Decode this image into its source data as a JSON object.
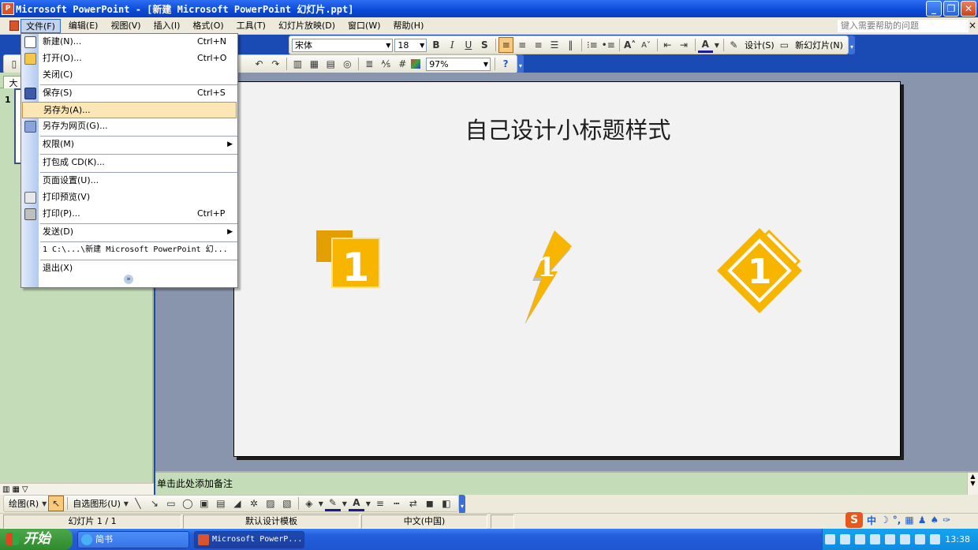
{
  "window": {
    "title": "Microsoft PowerPoint - [新建 Microsoft PowerPoint 幻灯片.ppt]",
    "app_icon": "powerpoint-icon",
    "controls": [
      "minimize",
      "restore",
      "close"
    ]
  },
  "menubar": {
    "items": [
      "文件(F)",
      "编辑(E)",
      "视图(V)",
      "插入(I)",
      "格式(O)",
      "工具(T)",
      "幻灯片放映(D)",
      "窗口(W)",
      "帮助(H)"
    ],
    "active_index": 0,
    "help_placeholder": "键入需要帮助的问题",
    "close_glyph": "×"
  },
  "formatting_toolbar": {
    "font": "宋体",
    "size": "18",
    "design_label": "设计(S)",
    "new_slide_label": "新幻灯片(N)"
  },
  "standard_toolbar": {
    "zoom": "97%"
  },
  "outline_pane": {
    "tab_label": "大",
    "slide_number": "1"
  },
  "slide": {
    "title": "自己设计小标题样式",
    "icon_labels": [
      "1",
      "1",
      "1"
    ],
    "accent_color": "#f7b500",
    "dark_color": "#e39f00"
  },
  "notes": {
    "placeholder": "单击此处添加备注"
  },
  "view_buttons": [
    "normal-view",
    "slide-sorter-view",
    "slide-show-view"
  ],
  "draw_toolbar": {
    "draw_label": "绘图(R)",
    "autoshapes_label": "自选图形(U)"
  },
  "statusbar": {
    "slide_info": "幻灯片 1 / 1",
    "template": "默认设计模板",
    "language": "中文(中国)"
  },
  "ime": {
    "mode": "中"
  },
  "taskbar": {
    "start_label": "开始",
    "tasks": [
      "简书",
      "Microsoft PowerP..."
    ],
    "clock": "13:38"
  },
  "file_menu": {
    "items": [
      {
        "label": "新建(N)...",
        "shortcut": "Ctrl+N",
        "icon": "new-document-icon"
      },
      {
        "label": "打开(O)...",
        "shortcut": "Ctrl+O",
        "icon": "open-folder-icon"
      },
      {
        "label": "关闭(C)",
        "shortcut": "",
        "icon": ""
      },
      {
        "label": "保存(S)",
        "shortcut": "Ctrl+S",
        "icon": "save-disk-icon"
      },
      {
        "label": "另存为(A)...",
        "shortcut": "",
        "icon": ""
      },
      {
        "label": "另存为网页(G)...",
        "shortcut": "",
        "icon": "save-web-icon"
      },
      {
        "label": "权限(M)",
        "shortcut": "",
        "icon": "",
        "submenu": true
      },
      {
        "label": "打包成 CD(K)...",
        "shortcut": "",
        "icon": ""
      },
      {
        "label": "页面设置(U)...",
        "shortcut": "",
        "icon": ""
      },
      {
        "label": "打印预览(V)",
        "shortcut": "",
        "icon": "print-preview-icon"
      },
      {
        "label": "打印(P)...",
        "shortcut": "Ctrl+P",
        "icon": "printer-icon"
      },
      {
        "label": "发送(D)",
        "shortcut": "",
        "icon": "",
        "submenu": true
      },
      {
        "label": "1 C:\\...\\新建 Microsoft PowerPoint 幻...",
        "shortcut": "",
        "icon": ""
      },
      {
        "label": "退出(X)",
        "shortcut": "",
        "icon": ""
      }
    ],
    "highlighted_index": 4,
    "submenu_glyph": "▶",
    "expand_glyph": "»"
  }
}
